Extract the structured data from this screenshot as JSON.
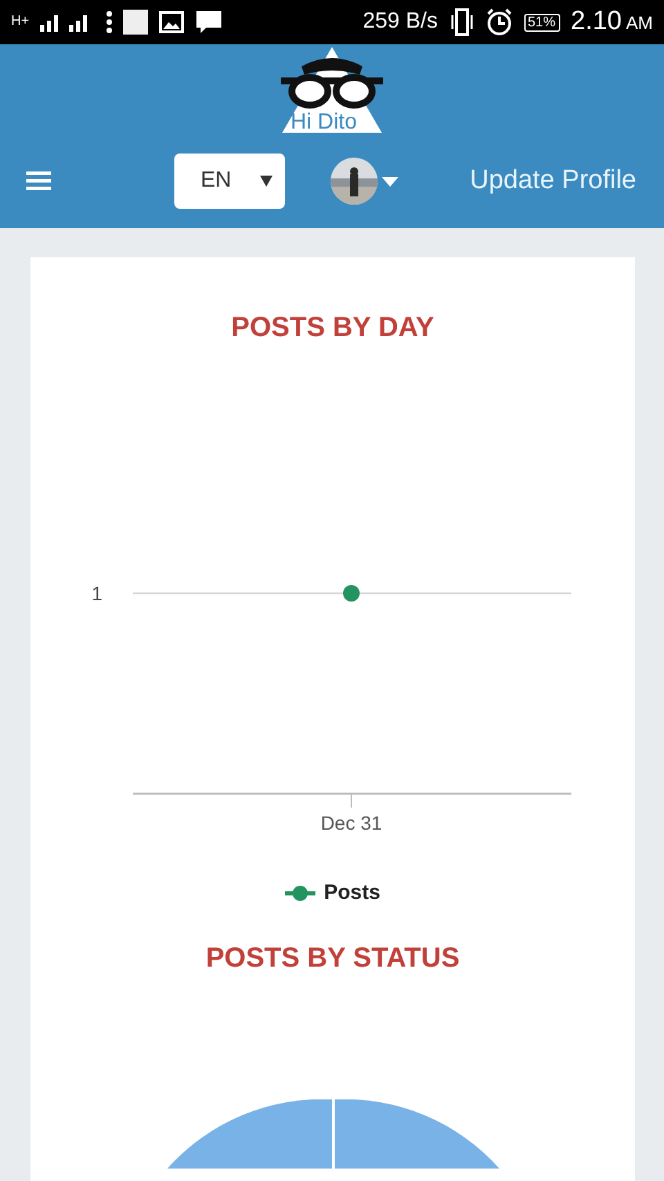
{
  "status_bar": {
    "network": "H+",
    "speed": "259 B/s",
    "battery": "51%",
    "time": "2.10",
    "meridiem": "AM"
  },
  "header": {
    "logo_text": "Hi Dito",
    "language": "EN",
    "update_profile": "Update Profile"
  },
  "charts": [
    {
      "kind": "line",
      "title": "POSTS BY DAY",
      "y_tick": "1",
      "x_tick": "Dec 31",
      "legend": "Posts"
    },
    {
      "kind": "pie",
      "title": "POSTS BY STATUS"
    }
  ]
}
